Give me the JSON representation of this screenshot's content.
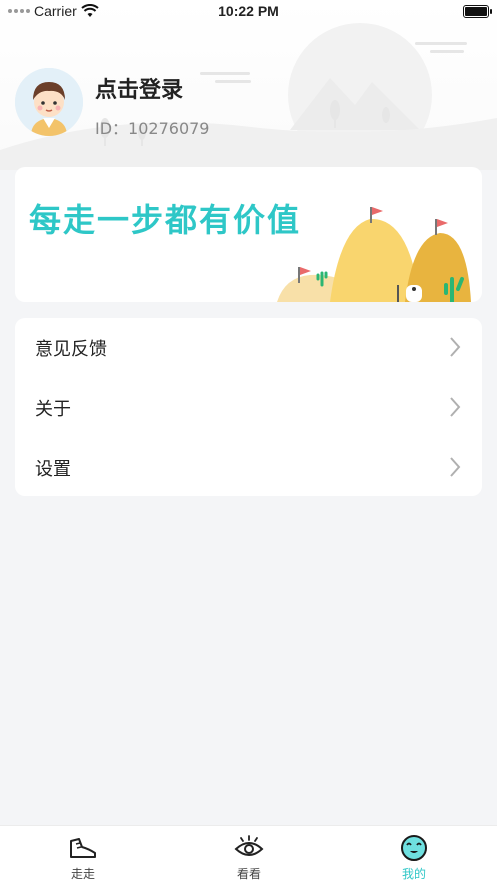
{
  "status_bar": {
    "carrier": "Carrier",
    "time": "10:22 PM",
    "wifi_icon": "wifi-icon",
    "battery_icon": "battery-icon"
  },
  "profile": {
    "login_label": "点击登录",
    "user_id": "ID：10276079",
    "avatar_icon": "avatar-icon"
  },
  "banner": {
    "slogan": "每走一步都有价值"
  },
  "menu": {
    "items": [
      {
        "label": "意见反馈",
        "icon": "chevron-right-icon"
      },
      {
        "label": "关于",
        "icon": "chevron-right-icon"
      },
      {
        "label": "设置",
        "icon": "chevron-right-icon"
      }
    ]
  },
  "tab_bar": {
    "tabs": [
      {
        "label": "走走",
        "icon": "shoe-icon",
        "active": false
      },
      {
        "label": "看看",
        "icon": "eye-icon",
        "active": false
      },
      {
        "label": "我的",
        "icon": "profile-face-icon",
        "active": true
      }
    ]
  },
  "colors": {
    "accent": "#2ec7c7",
    "background": "#f4f5f7",
    "card": "#ffffff",
    "text_secondary": "#888888"
  }
}
